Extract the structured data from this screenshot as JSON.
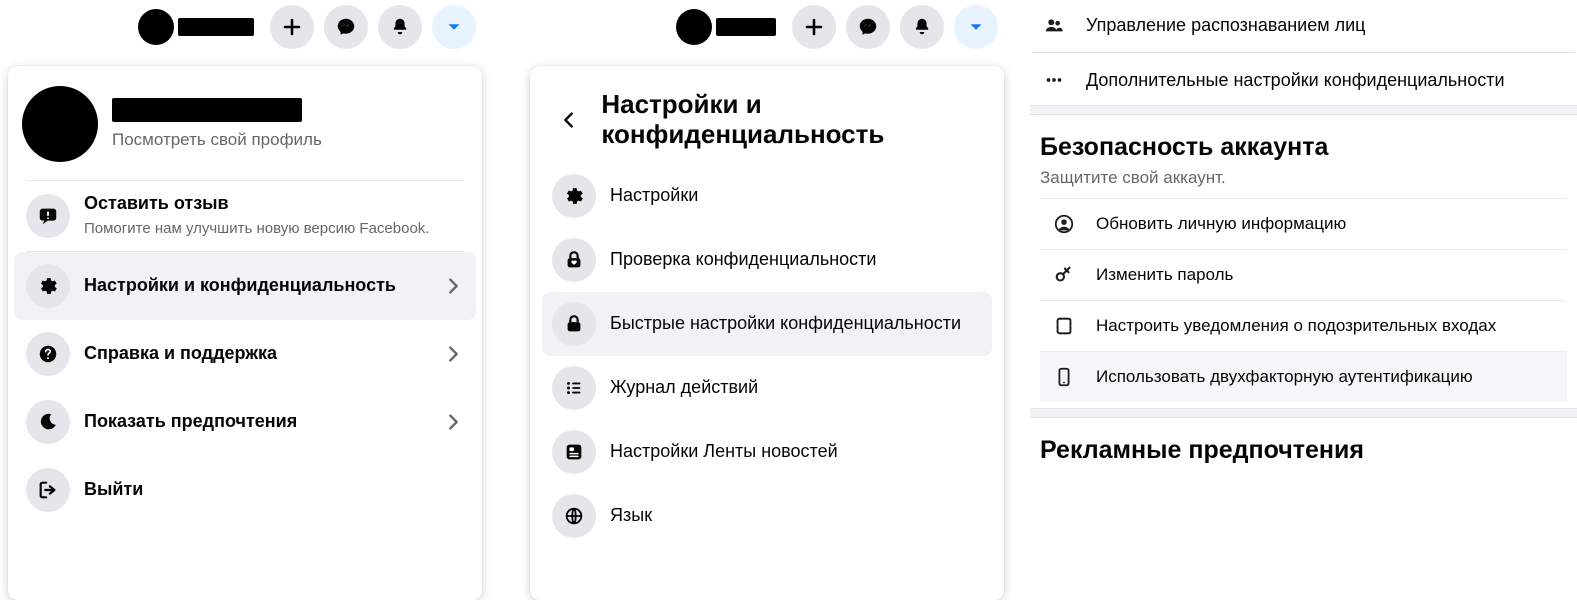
{
  "panel1": {
    "profile_sub": "Посмотреть свой профиль",
    "feedback": {
      "title": "Оставить отзыв",
      "sub": "Помогите нам улучшить новую версию Facebook."
    },
    "items": [
      {
        "label": "Настройки и конфиденциальность",
        "icon": "gear"
      },
      {
        "label": "Справка и поддержка",
        "icon": "help"
      },
      {
        "label": "Показать предпочтения",
        "icon": "moon"
      },
      {
        "label": "Выйти",
        "icon": "logout"
      }
    ]
  },
  "panel2": {
    "title": "Настройки и конфиденциальность",
    "items": [
      {
        "label": "Настройки",
        "icon": "gear"
      },
      {
        "label": "Проверка конфиденциальности",
        "icon": "lock-heart"
      },
      {
        "label": "Быстрые настройки конфиденциальности",
        "icon": "lock"
      },
      {
        "label": "Журнал действий",
        "icon": "list"
      },
      {
        "label": "Настройки Ленты новостей",
        "icon": "feed"
      },
      {
        "label": "Язык",
        "icon": "globe"
      }
    ]
  },
  "panel3": {
    "top_rows": [
      {
        "label": "Управление распознаванием лиц",
        "icon": "users"
      },
      {
        "label": "Дополнительные настройки конфиденциальности",
        "icon": "dots"
      }
    ],
    "security": {
      "title": "Безопасность аккаунта",
      "desc": "Защитите свой аккаунт.",
      "items": [
        {
          "label": "Обновить личную информацию",
          "icon": "profile"
        },
        {
          "label": "Изменить пароль",
          "icon": "key"
        },
        {
          "label": "Настроить уведомления о подозрительных входах",
          "icon": "alert"
        },
        {
          "label": "Использовать двухфакторную аутентификацию",
          "icon": "phone"
        }
      ]
    },
    "ads_title": "Рекламные предпочтения"
  }
}
